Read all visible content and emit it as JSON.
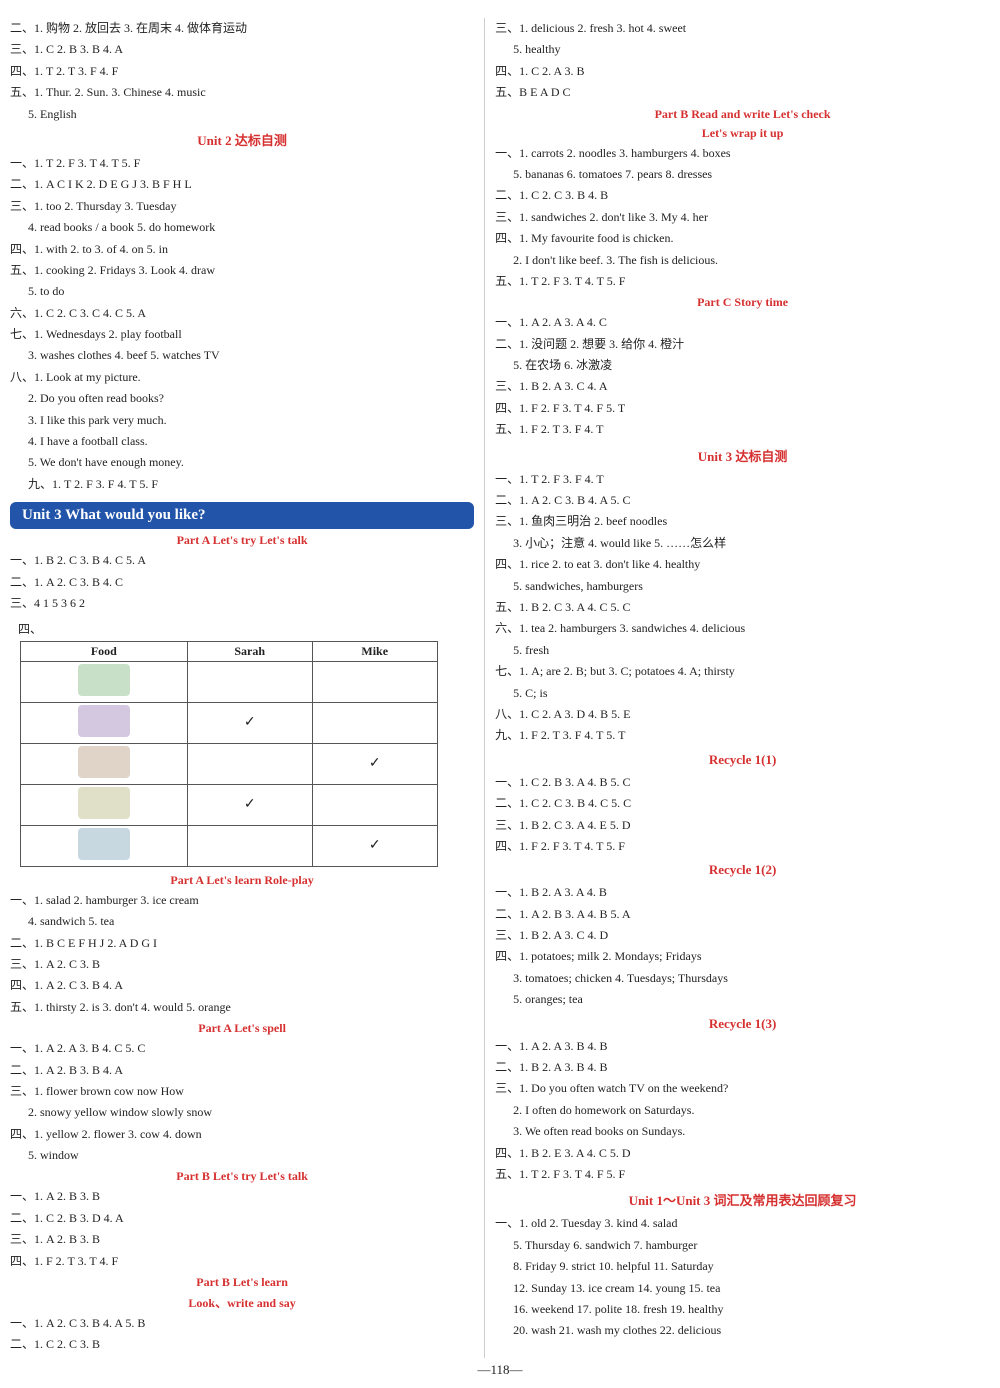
{
  "page_number": "—118—",
  "left": {
    "lines": [
      "二、1. 购物  2. 放回去  3. 在周末  4. 做体育运动",
      "三、1. C  2. B  3. B  4. A",
      "四、1. T  2. T  3. F  4. F",
      "五、1. Thur.  2. Sun.  3. Chinese  4. music",
      "    5. English"
    ],
    "unit2_title": "Unit 2 达标自测",
    "unit2_lines": [
      "一、1. T  2. F  3. T  4. T  5. F",
      "二、1. A C I K  2. D E G J  3. B F H L",
      "三、1. too  2. Thursday  3. Tuesday",
      "    4. read books / a book  5. do homework",
      "四、1. with  2. to  3. of  4. on  5. in",
      "五、1. cooking  2. Fridays  3. Look  4. draw",
      "    5. to do",
      "六、1. C  2. C  3. C  4. C  5. A",
      "七、1. Wednesdays  2. play football",
      "    3. washes clothes  4. beef  5. watches TV",
      "八、1. Look at my picture.",
      "    2. Do you often read books?",
      "    3. I like this park very much.",
      "    4. I have a football class.",
      "    5. We don't have enough money.",
      "九、1. T  2. F  3. F  4. T  5. F"
    ],
    "unit3_banner": "Unit 3  What would you like?",
    "part_a_title": "Part A   Let's try   Let's talk",
    "part_a_lines": [
      "一、1. B  2. C  3. B  4. C  5. A",
      "二、1. A  2. C  3. B  4. C",
      "三、4  1  5  3  6  2"
    ],
    "table_header": [
      "Food",
      "Sarah",
      "Mike"
    ],
    "table_rows": [
      [
        "[food1]",
        "",
        ""
      ],
      [
        "[food2]",
        "✓",
        ""
      ],
      [
        "[food3]",
        "",
        "✓"
      ],
      [
        "[food4]",
        "✓",
        ""
      ],
      [
        "[food5]",
        "",
        "✓"
      ]
    ],
    "part_a2_title": "Part A   Let's learn   Role-play",
    "part_a2_lines": [
      "一、1. salad  2. hamburger  3. ice cream",
      "    4. sandwich  5. tea",
      "二、1. B C E F H J  2. A D G I",
      "三、1. A  2. C  3. B",
      "四、1. A  2. C  3. B  4. A",
      "五、1. thirsty  2. is  3. don't  4. would  5. orange"
    ],
    "part_a3_title": "Part A   Let's spell",
    "part_a3_lines": [
      "一、1. A  2. A  3. B  4. C  5. C",
      "二、1. A  2. B  3. B  4. A",
      "三、1. flower  brown  cow  now  How",
      "    2. snowy  yellow  window  slowly  snow",
      "四、1. yellow  2. flower  3. cow  4. down",
      "    5. window"
    ],
    "part_b_title": "Part B   Let's try   Let's talk",
    "part_b_lines": [
      "一、1. A  2. B  3. B",
      "二、1. C  2. B  3. D  4. A",
      "三、1. A  2. B  3. B",
      "四、1. F  2. T  3. T  4. F"
    ],
    "part_b2_title": "Part B   Let's learn",
    "part_b2_sub": "Look、write and say",
    "part_b2_lines": [
      "一、1. A  2. C  3. B  4. A  5. B",
      "二、1. C  2. C  3. B"
    ]
  },
  "right": {
    "top_lines": [
      "三、1. delicious  2. fresh  3. hot  4. sweet",
      "    5. healthy",
      "四、1. C  2. A  3. B",
      "五、B  E  A  D  C"
    ],
    "part_b3_title": "Part B   Read and write   Let's check",
    "part_b3_sub": "Let's wrap it up",
    "part_b3_lines": [
      "一、1. carrots  2. noodles  3. hamburgers  4. boxes",
      "    5. bananas  6. tomatoes  7. pears  8. dresses",
      "二、1. C  2. C  3. B  4. B",
      "三、1. sandwiches  2. don't like  3. My  4. her",
      "四、1. My favourite food is chicken.",
      "    2. I don't like beef.  3. The fish is delicious.",
      "五、1. T  2. F  3. T  4. T  5. F"
    ],
    "part_c_title": "Part C   Story time",
    "part_c_lines": [
      "一、1. A  2. A  3. A  4. C",
      "二、1. 没问题  2. 想要  3. 给你  4. 橙汁",
      "    5. 在农场  6. 冰激凌",
      "三、1. B  2. A  3. C  4. A",
      "四、1. F  2. F  3. T  4. F  5. T",
      "五、1. F  2. T  3. F  4. T"
    ],
    "unit3_title": "Unit 3 达标自测",
    "unit3_lines": [
      "一、1. T  2. F  3. F  4. T",
      "二、1. A  2. C  3. B  4. A  5. C",
      "三、1. 鱼肉三明治  2. beef noodles",
      "    3. 小心；注意  4. would like  5. ……怎么样",
      "四、1. rice  2. to eat  3. don't like  4. healthy",
      "    5. sandwiches, hamburgers",
      "五、1. B  2. C  3. A  4. C  5. C",
      "六、1. tea  2. hamburgers  3. sandwiches  4. delicious",
      "    5. fresh",
      "七、1. A; are  2. B; but  3. C; potatoes  4. A; thirsty",
      "    5. C; is",
      "八、1. C  2. A  3. D  4. B  5. E",
      "九、1. F  2. T  3. F  4. T  5. T"
    ],
    "recycle1_1_title": "Recycle 1(1)",
    "recycle1_1_lines": [
      "一、1. C  2. B  3. A  4. B  5. C",
      "二、1. C  2. C  3. B  4. C  5. C",
      "三、1. B  2. C  3. A  4. E  5. D",
      "四、1. F  2. F  3. T  4. T  5. F"
    ],
    "recycle1_2_title": "Recycle 1(2)",
    "recycle1_2_lines": [
      "一、1. B  2. A  3. A  4. B",
      "二、1. A  2. B  3. A  4. B  5. A",
      "三、1. B  2. A  3. C  4. D",
      "四、1. potatoes; milk  2. Mondays; Fridays",
      "    3. tomatoes; chicken  4. Tuesdays; Thursdays",
      "    5. oranges; tea"
    ],
    "recycle1_3_title": "Recycle 1(3)",
    "recycle1_3_lines": [
      "一、1. A  2. A  3. B  4. B",
      "二、1. B  2. A  3. B  4. B",
      "三、1. Do you often watch TV on the weekend?",
      "    2. I often do homework on Saturdays.",
      "    3. We often read books on Sundays.",
      "四、1. B  2. E  3. A  4. C  5. D",
      "五、1. T  2. F  3. T  4. F  5. F"
    ],
    "unit1_3_title": "Unit 1～Unit 3 词汇及常用表达回顾复习",
    "unit1_3_lines": [
      "一、1. old  2. Tuesday  3. kind  4. salad",
      "    5. Thursday  6. sandwich  7. hamburger",
      "    8. Friday  9. strict  10. helpful  11. Saturday",
      "    12. Sunday  13. ice cream  14. young  15. tea",
      "    16. weekend  17. polite  18. fresh  19. healthy",
      "    20. wash  21. wash my clothes  22. delicious"
    ]
  }
}
